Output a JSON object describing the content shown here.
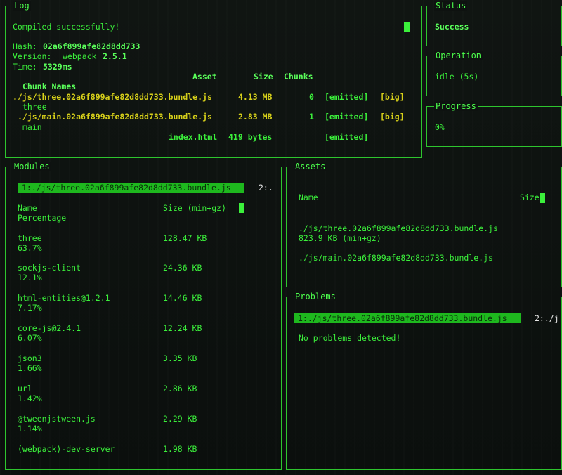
{
  "log": {
    "title": "Log",
    "compiled": "Compiled successfully!",
    "hash_label": "Hash:",
    "hash_value": "02a6f899afe82d8dd733",
    "version_label": "Version:",
    "version_prefix": "webpack",
    "version_value": "2.5.1",
    "time_label": "Time:",
    "time_value": "5329ms",
    "headers": {
      "asset": "Asset",
      "size": "Size",
      "chunks": "Chunks",
      "chunk_names": "Chunk Names"
    },
    "rows": [
      {
        "asset": "./js/three.02a6f899afe82d8dd733.bundle.js",
        "size": "4.13 MB",
        "chunk": "0",
        "emitted": "[emitted]",
        "flag": "[big]",
        "name": "three"
      },
      {
        "asset": "./js/main.02a6f899afe82d8dd733.bundle.js",
        "size": "2.83 MB",
        "chunk": "1",
        "emitted": "[emitted]",
        "flag": "[big]",
        "name": "main"
      },
      {
        "asset": "index.html",
        "size": "419 bytes",
        "chunk": "",
        "emitted": "[emitted]",
        "flag": "",
        "name": ""
      }
    ]
  },
  "status": {
    "title": "Status",
    "value": "Success"
  },
  "operation": {
    "title": "Operation",
    "value": "idle (5s)"
  },
  "progress": {
    "title": "Progress",
    "value": "0%",
    "fraction": 0
  },
  "modules": {
    "title": "Modules",
    "tab_active": "1:./js/three.02a6f899afe82d8dd733.bundle.js",
    "tab_next": "2:.",
    "col_name": "Name",
    "col_size": "Size (min+gz)",
    "col_pct": "Percentage",
    "rows": [
      {
        "name": "three",
        "size": "128.47 KB",
        "pct": "63.7%"
      },
      {
        "name": "sockjs-client",
        "size": "24.36 KB",
        "pct": "12.1%"
      },
      {
        "name": "html-entities@1.2.1",
        "size": "14.46 KB",
        "pct": "7.17%"
      },
      {
        "name": "core-js@2.4.1",
        "size": "12.24 KB",
        "pct": "6.07%"
      },
      {
        "name": "json3",
        "size": "3.35 KB",
        "pct": "1.66%"
      },
      {
        "name": "url",
        "size": "2.86 KB",
        "pct": "1.42%"
      },
      {
        "name": "@tweenjstween.js",
        "size": "2.29 KB",
        "pct": "1.14%"
      },
      {
        "name": "(webpack)-dev-server",
        "size": "1.98 KB",
        "pct": ""
      }
    ]
  },
  "assets": {
    "title": "Assets",
    "col_name": "Name",
    "col_size": "Size",
    "rows": [
      {
        "name": "./js/three.02a6f899afe82d8dd733.bundle.js",
        "size": "823.9 KB (min+gz)"
      },
      {
        "name": "./js/main.02a6f899afe82d8dd733.bundle.js",
        "size": ""
      }
    ]
  },
  "problems": {
    "title": "Problems",
    "tab_active": "1:./js/three.02a6f899afe82d8dd733.bundle.js",
    "tab_next": "2:./j",
    "message": "No problems detected!"
  }
}
